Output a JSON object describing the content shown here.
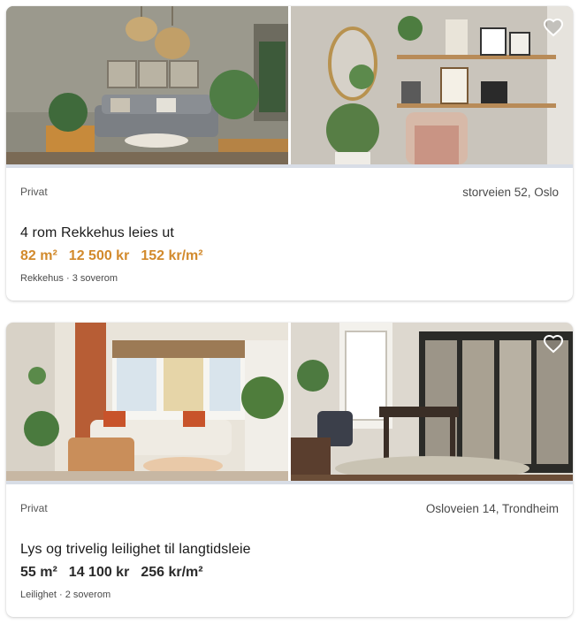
{
  "listings": [
    {
      "seller": "Privat",
      "address": "storveien 52, Oslo",
      "title": "4 rom Rekkehus leies ut",
      "stats": [
        "82 m²",
        "12 500 kr",
        "152 kr/m²"
      ],
      "meta": "Rekkehus · 3 soverom",
      "accent": "#d28a2c"
    },
    {
      "seller": "Privat",
      "address": "Osloveien 14, Trondheim",
      "title": "Lys og trivelig leilighet til langtidsleie",
      "stats": [
        "55 m²",
        "14 100 kr",
        "256 kr/m²"
      ],
      "meta": "Leilighet · 2 soverom",
      "accent": "#2a2a2a"
    }
  ],
  "icons": {
    "favorite": "heart-outline-icon"
  }
}
